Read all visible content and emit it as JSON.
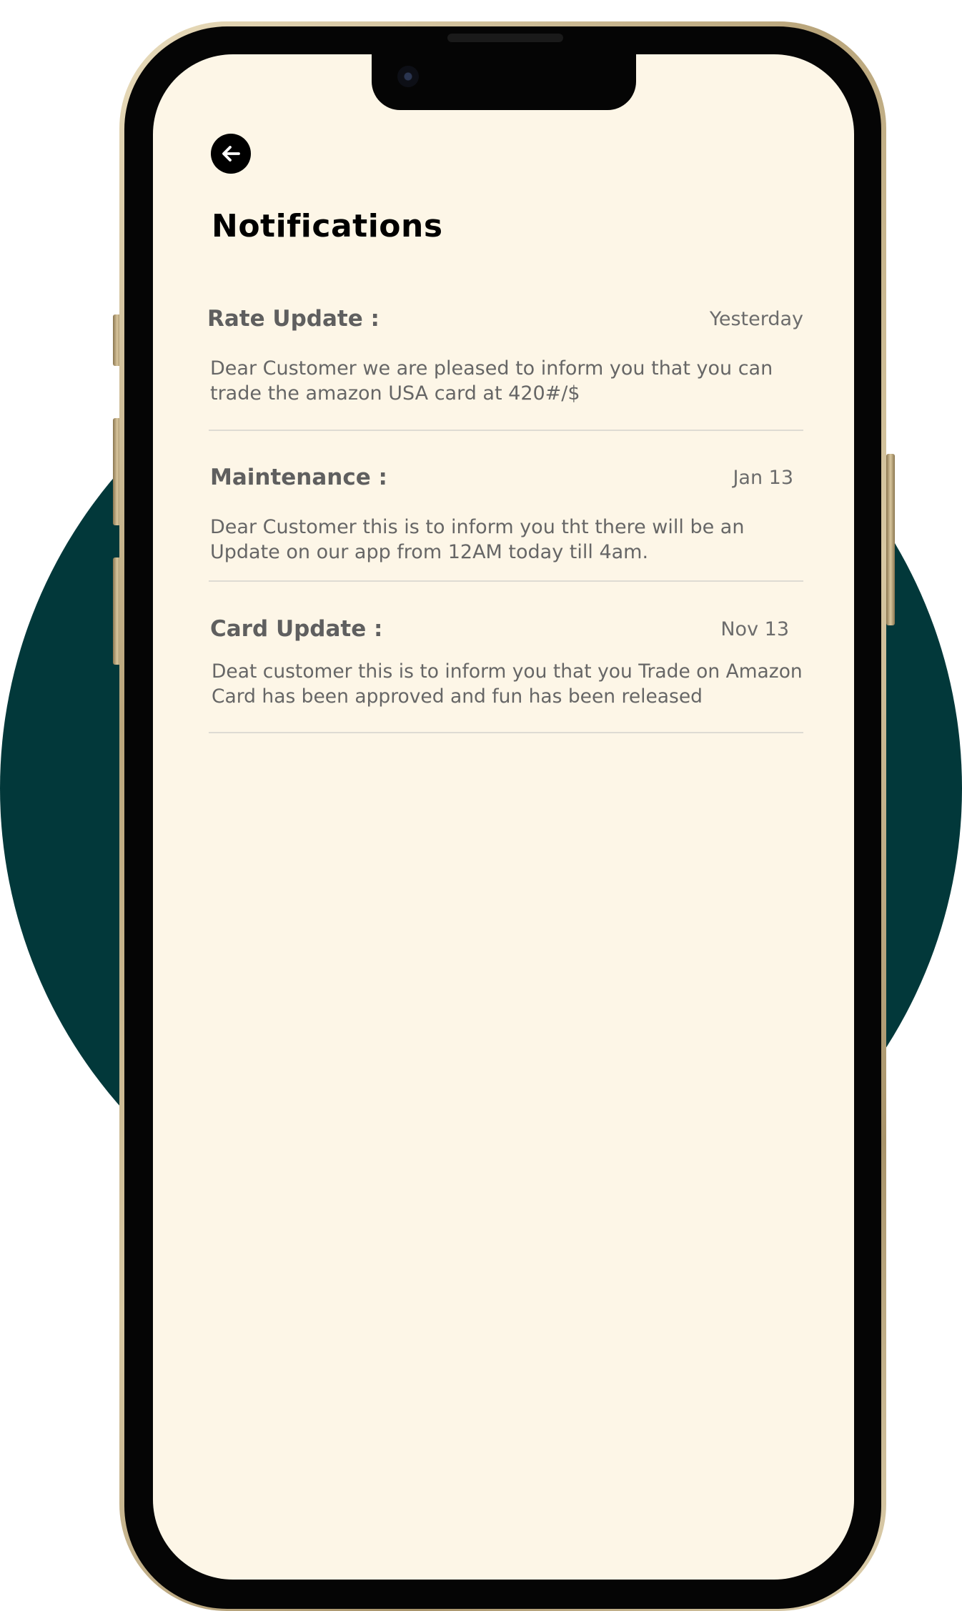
{
  "header": {
    "title": "Notifications"
  },
  "notifications": [
    {
      "title": "Rate Update :",
      "date": "Yesterday",
      "body": "Dear Customer we are pleased to inform you that you can trade the amazon USA card at 420#/$"
    },
    {
      "title": "Maintenance :",
      "date": "Jan 13",
      "body": "Dear Customer this is to inform you tht there will be an Update on our app from 12AM today till 4am."
    },
    {
      "title": "Card Update :",
      "date": "Nov 13",
      "body": "Deat customer this is to inform you that you Trade on Amazon Card has been approved and fun has been released"
    }
  ],
  "colors": {
    "background_circle": "#02383a",
    "screen": "#fdf6e7",
    "frame_gold": "#c8b68c"
  },
  "icons": {
    "back": "arrow-left-icon"
  }
}
